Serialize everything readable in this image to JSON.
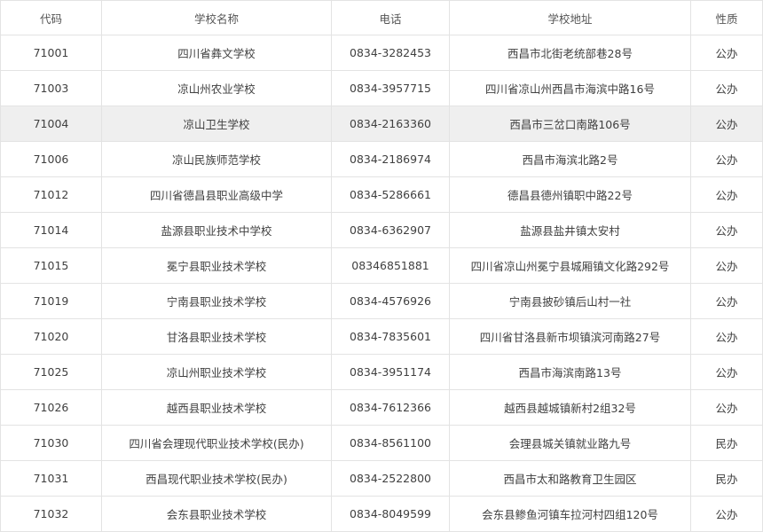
{
  "table": {
    "headers": [
      "代码",
      "学校名称",
      "电话",
      "学校地址",
      "性质"
    ],
    "highlighted_row": 2,
    "rows": [
      [
        "71001",
        "四川省彝文学校",
        "0834-3282453",
        "西昌市北街老统部巷28号",
        "公办"
      ],
      [
        "71003",
        "凉山州农业学校",
        "0834-3957715",
        "四川省凉山州西昌市海滨中路16号",
        "公办"
      ],
      [
        "71004",
        "凉山卫生学校",
        "0834-2163360",
        "西昌市三岔口南路106号",
        "公办"
      ],
      [
        "71006",
        "凉山民族师范学校",
        "0834-2186974",
        "西昌市海滨北路2号",
        "公办"
      ],
      [
        "71012",
        "四川省德昌县职业高级中学",
        "0834-5286661",
        "德昌县德州镇职中路22号",
        "公办"
      ],
      [
        "71014",
        "盐源县职业技术中学校",
        "0834-6362907",
        "盐源县盐井镇太安村",
        "公办"
      ],
      [
        "71015",
        "冕宁县职业技术学校",
        "08346851881",
        "四川省凉山州冕宁县城厢镇文化路292号",
        "公办"
      ],
      [
        "71019",
        "宁南县职业技术学校",
        "0834-4576926",
        "宁南县披砂镇后山村一社",
        "公办"
      ],
      [
        "71020",
        "甘洛县职业技术学校",
        "0834-7835601",
        "四川省甘洛县新市坝镇滨河南路27号",
        "公办"
      ],
      [
        "71025",
        "凉山州职业技术学校",
        "0834-3951174",
        "西昌市海滨南路13号",
        "公办"
      ],
      [
        "71026",
        "越西县职业技术学校",
        "0834-7612366",
        "越西县越城镇新村2组32号",
        "公办"
      ],
      [
        "71030",
        "四川省会理现代职业技术学校(民办)",
        "0834-8561100",
        "会理县城关镇就业路九号",
        "民办"
      ],
      [
        "71031",
        "西昌现代职业技术学校(民办)",
        "0834-2522800",
        "西昌市太和路教育卫生园区",
        "民办"
      ],
      [
        "71032",
        "会东县职业技术学校",
        "0834-8049599",
        "会东县鲹鱼河镇车拉河村四组120号",
        "公办"
      ]
    ]
  }
}
